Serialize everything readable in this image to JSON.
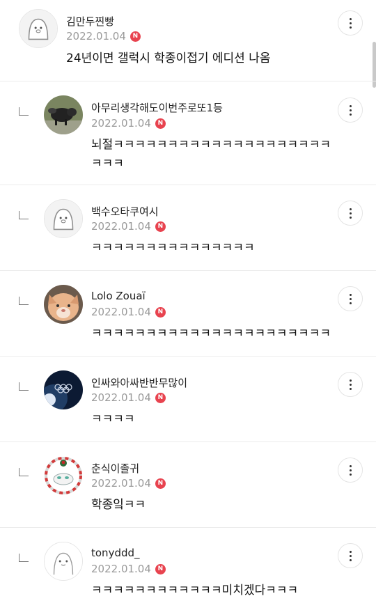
{
  "comments": [
    {
      "nick": "김만두찐빵",
      "date": "2022.01.04",
      "badge": "N",
      "text": "24년이면 갤럭시 학종이접기 에디션 나옴",
      "avatar": "default-penguin-avatar",
      "reply": false
    },
    {
      "nick": "아무리생각해도이번주로또1등",
      "date": "2022.01.04",
      "badge": "N",
      "text": "뇌절ㅋㅋㅋㅋㅋㅋㅋㅋㅋㅋㅋㅋㅋㅋㅋㅋㅋㅋㅋㅋㅋㅋㅋ",
      "avatar": "pig-photo-avatar",
      "reply": true
    },
    {
      "nick": "백수오타쿠여시",
      "date": "2022.01.04",
      "badge": "N",
      "text": "ㅋㅋㅋㅋㅋㅋㅋㅋㅋㅋㅋㅋㅋㅋㅋ",
      "avatar": "default-penguin-avatar",
      "reply": true
    },
    {
      "nick": "Lolo Zouaï",
      "date": "2022.01.04",
      "badge": "N",
      "text": "ㅋㅋㅋㅋㅋㅋㅋㅋㅋㅋㅋㅋㅋㅋㅋㅋㅋㅋㅋㅋㅋㅋ",
      "avatar": "cat-photo-avatar",
      "reply": true
    },
    {
      "nick": "인싸와아싸반반무많이",
      "date": "2022.01.04",
      "badge": "N",
      "text": "ㅋㅋㅋㅋ",
      "avatar": "olympic-rings-avatar",
      "reply": true
    },
    {
      "nick": "춘식이졸귀",
      "date": "2022.01.04",
      "badge": "N",
      "text": "학종잌ㅋㅋ",
      "avatar": "character-wreath-avatar",
      "reply": true
    },
    {
      "nick": "tonyddd_",
      "date": "2022.01.04",
      "badge": "N",
      "text": "ㅋㅋㅋㅋㅋㅋㅋㅋㅋㅋㅋㅋ미치겠다ㅋㅋㅋ",
      "avatar": "bear-drawing-avatar",
      "reply": true
    }
  ],
  "icons": {
    "more": "more-vertical-icon",
    "reply": "reply-arrow-icon",
    "new": "new-badge"
  },
  "colors": {
    "badge": "#e8434f",
    "date": "#9a9a9a",
    "divider": "#ececec"
  }
}
